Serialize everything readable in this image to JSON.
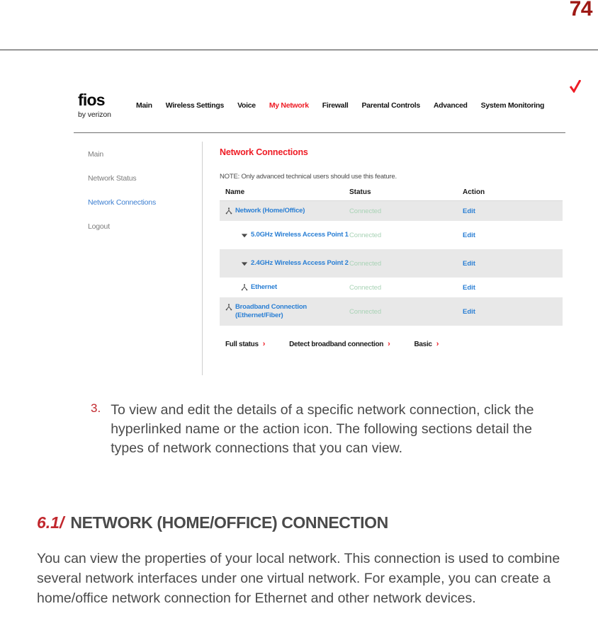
{
  "page": {
    "number": "74"
  },
  "router_ui": {
    "logo": {
      "mark": "fios",
      "sub": "by verizon",
      "check_color": "#ee1c25"
    },
    "nav": [
      {
        "label": "Main",
        "active": false
      },
      {
        "label": "Wireless Settings",
        "active": false
      },
      {
        "label": "Voice",
        "active": false
      },
      {
        "label": "My Network",
        "active": true
      },
      {
        "label": "Firewall",
        "active": false
      },
      {
        "label": "Parental Controls",
        "active": false
      },
      {
        "label": "Advanced",
        "active": false
      },
      {
        "label": "System Monitoring",
        "active": false
      }
    ],
    "sidebar": [
      {
        "label": "Main",
        "current": false
      },
      {
        "label": "Network Status",
        "current": false
      },
      {
        "label": "Network Connections",
        "current": true
      },
      {
        "label": "Logout",
        "current": false
      }
    ],
    "content": {
      "title": "Network Connections",
      "note": "NOTE: Only advanced technical users should use this feature.",
      "columns": {
        "name": "Name",
        "status": "Status",
        "action": "Action"
      },
      "rows": [
        {
          "name": "Network (Home/Office)",
          "status": "Connected",
          "action": "Edit",
          "icon": "network-node-icon",
          "indent": false,
          "shaded": true,
          "tall": false
        },
        {
          "name": "5.0GHz Wireless Access Point 1",
          "status": "Connected",
          "action": "Edit",
          "icon": "wifi-icon",
          "indent": true,
          "shaded": false,
          "tall": true
        },
        {
          "name": "2.4GHz Wireless Access Point 2",
          "status": "Connected",
          "action": "Edit",
          "icon": "wifi-icon",
          "indent": true,
          "shaded": true,
          "tall": true
        },
        {
          "name": "Ethernet",
          "status": "Connected",
          "action": "Edit",
          "icon": "network-node-icon",
          "indent": true,
          "shaded": false,
          "tall": false
        },
        {
          "name": "Broadband Connection (Ethernet/Fiber)",
          "status": "Connected",
          "action": "Edit",
          "icon": "network-node-icon",
          "indent": false,
          "shaded": true,
          "tall": true
        }
      ],
      "footer_links": [
        {
          "label": "Full status",
          "chevron": "›"
        },
        {
          "label": "Detect broadband connection",
          "chevron": "›"
        },
        {
          "label": "Basic",
          "chevron": "›"
        }
      ]
    },
    "colors": {
      "accent_red": "#ee1c25",
      "link_blue": "#2a7fd4",
      "status_green": "#a9d3b6",
      "row_shade": "#e8e8e8"
    }
  },
  "manual": {
    "step": {
      "number": "3.",
      "text": "To view and edit the details of a specific network connection, click the hyperlinked name or the action icon. The following sections detail the types of network connections that you can view."
    },
    "section": {
      "number": "6.1/",
      "title": "NETWORK (HOME/OFFICE) CONNECTION"
    },
    "body": "You can view the properties of your local network. This connection is used to combine several network interfaces under one virtual network. For example, you can create a home/office network connection for Ethernet and other network devices."
  }
}
